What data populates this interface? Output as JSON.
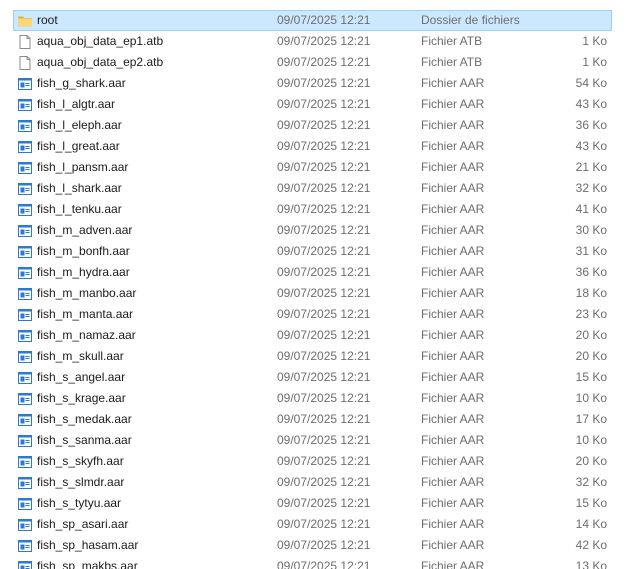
{
  "window": {
    "selected_index": 0
  },
  "files": [
    {
      "name": "root",
      "date": "09/07/2025 12:21",
      "type": "Dossier de fichiers",
      "size": "",
      "icon": "folder-icon"
    },
    {
      "name": "aqua_obj_data_ep1.atb",
      "date": "09/07/2025 12:21",
      "type": "Fichier ATB",
      "size": "1 Ko",
      "icon": "document-icon"
    },
    {
      "name": "aqua_obj_data_ep2.atb",
      "date": "09/07/2025 12:21",
      "type": "Fichier ATB",
      "size": "1 Ko",
      "icon": "document-icon"
    },
    {
      "name": "fish_g_shark.aar",
      "date": "09/07/2025 12:21",
      "type": "Fichier AAR",
      "size": "54 Ko",
      "icon": "app-file-icon"
    },
    {
      "name": "fish_l_algtr.aar",
      "date": "09/07/2025 12:21",
      "type": "Fichier AAR",
      "size": "43 Ko",
      "icon": "app-file-icon"
    },
    {
      "name": "fish_l_eleph.aar",
      "date": "09/07/2025 12:21",
      "type": "Fichier AAR",
      "size": "36 Ko",
      "icon": "app-file-icon"
    },
    {
      "name": "fish_l_great.aar",
      "date": "09/07/2025 12:21",
      "type": "Fichier AAR",
      "size": "43 Ko",
      "icon": "app-file-icon"
    },
    {
      "name": "fish_l_pansm.aar",
      "date": "09/07/2025 12:21",
      "type": "Fichier AAR",
      "size": "21 Ko",
      "icon": "app-file-icon"
    },
    {
      "name": "fish_l_shark.aar",
      "date": "09/07/2025 12:21",
      "type": "Fichier AAR",
      "size": "32 Ko",
      "icon": "app-file-icon"
    },
    {
      "name": "fish_l_tenku.aar",
      "date": "09/07/2025 12:21",
      "type": "Fichier AAR",
      "size": "41 Ko",
      "icon": "app-file-icon"
    },
    {
      "name": "fish_m_adven.aar",
      "date": "09/07/2025 12:21",
      "type": "Fichier AAR",
      "size": "30 Ko",
      "icon": "app-file-icon"
    },
    {
      "name": "fish_m_bonfh.aar",
      "date": "09/07/2025 12:21",
      "type": "Fichier AAR",
      "size": "31 Ko",
      "icon": "app-file-icon"
    },
    {
      "name": "fish_m_hydra.aar",
      "date": "09/07/2025 12:21",
      "type": "Fichier AAR",
      "size": "36 Ko",
      "icon": "app-file-icon"
    },
    {
      "name": "fish_m_manbo.aar",
      "date": "09/07/2025 12:21",
      "type": "Fichier AAR",
      "size": "18 Ko",
      "icon": "app-file-icon"
    },
    {
      "name": "fish_m_manta.aar",
      "date": "09/07/2025 12:21",
      "type": "Fichier AAR",
      "size": "23 Ko",
      "icon": "app-file-icon"
    },
    {
      "name": "fish_m_namaz.aar",
      "date": "09/07/2025 12:21",
      "type": "Fichier AAR",
      "size": "20 Ko",
      "icon": "app-file-icon"
    },
    {
      "name": "fish_m_skull.aar",
      "date": "09/07/2025 12:21",
      "type": "Fichier AAR",
      "size": "20 Ko",
      "icon": "app-file-icon"
    },
    {
      "name": "fish_s_angel.aar",
      "date": "09/07/2025 12:21",
      "type": "Fichier AAR",
      "size": "15 Ko",
      "icon": "app-file-icon"
    },
    {
      "name": "fish_s_krage.aar",
      "date": "09/07/2025 12:21",
      "type": "Fichier AAR",
      "size": "10 Ko",
      "icon": "app-file-icon"
    },
    {
      "name": "fish_s_medak.aar",
      "date": "09/07/2025 12:21",
      "type": "Fichier AAR",
      "size": "17 Ko",
      "icon": "app-file-icon"
    },
    {
      "name": "fish_s_sanma.aar",
      "date": "09/07/2025 12:21",
      "type": "Fichier AAR",
      "size": "10 Ko",
      "icon": "app-file-icon"
    },
    {
      "name": "fish_s_skyfh.aar",
      "date": "09/07/2025 12:21",
      "type": "Fichier AAR",
      "size": "20 Ko",
      "icon": "app-file-icon"
    },
    {
      "name": "fish_s_slmdr.aar",
      "date": "09/07/2025 12:21",
      "type": "Fichier AAR",
      "size": "32 Ko",
      "icon": "app-file-icon"
    },
    {
      "name": "fish_s_tytyu.aar",
      "date": "09/07/2025 12:21",
      "type": "Fichier AAR",
      "size": "15 Ko",
      "icon": "app-file-icon"
    },
    {
      "name": "fish_sp_asari.aar",
      "date": "09/07/2025 12:21",
      "type": "Fichier AAR",
      "size": "14 Ko",
      "icon": "app-file-icon"
    },
    {
      "name": "fish_sp_hasam.aar",
      "date": "09/07/2025 12:21",
      "type": "Fichier AAR",
      "size": "42 Ko",
      "icon": "app-file-icon"
    },
    {
      "name": "fish_sp_makbs.aar",
      "date": "09/07/2025 12:21",
      "type": "Fichier AAR",
      "size": "13 Ko",
      "icon": "app-file-icon"
    }
  ],
  "colors": {
    "selection_bg": "#cce8ff",
    "selection_border": "#99d1ff",
    "folder": "#f8d775",
    "app_icon_blue": "#2b79d0"
  }
}
